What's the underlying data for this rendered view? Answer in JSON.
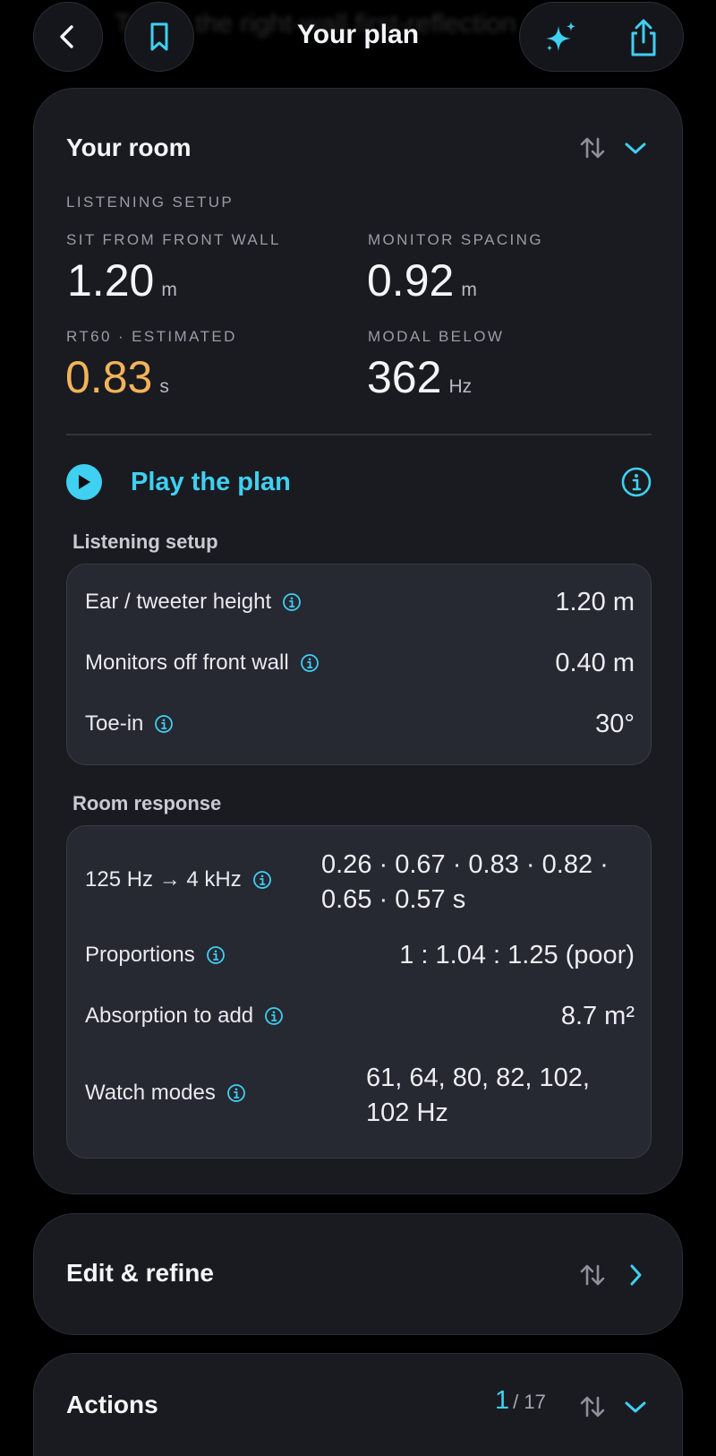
{
  "topbar": {
    "title": "Your plan",
    "behind_text": "Toe-in the right-wall first-reflection",
    "icons": {
      "back": "chevron-left-icon",
      "bookmark": "bookmark-icon",
      "sparkle": "sparkle-icon",
      "share": "share-icon"
    }
  },
  "room_card": {
    "title": "Your room",
    "section_label": "LISTENING SETUP",
    "metrics": [
      {
        "label": "SIT FROM FRONT WALL",
        "value": "1.20",
        "unit": "m"
      },
      {
        "label": "MONITOR SPACING",
        "value": "0.92",
        "unit": "m"
      },
      {
        "label": "RT60 · ESTIMATED",
        "value": "0.83",
        "unit": "s"
      },
      {
        "label": "MODAL BELOW",
        "value": "362",
        "unit": "Hz"
      }
    ],
    "play_label": "Play the plan",
    "listening_group": {
      "label": "Listening setup",
      "rows": [
        {
          "label": "Ear / tweeter height",
          "value": "1.20 m"
        },
        {
          "label": "Monitors off front wall",
          "value": "0.40 m"
        },
        {
          "label": "Toe-in",
          "value": "30°"
        }
      ]
    },
    "response_group": {
      "label": "Room response",
      "rows": [
        {
          "label": "125 Hz → 4 kHz",
          "value": "0.26 · 0.67 · 0.83 · 0.82 · 0.65 · 0.57 s"
        },
        {
          "label": "Proportions",
          "value": "1 : 1.04 : 1.25 (poor)"
        },
        {
          "label": "Absorption to add",
          "value": "8.7 m²"
        },
        {
          "label": "Watch modes",
          "value": "61, 64, 80, 82, 102, 102 Hz"
        }
      ]
    }
  },
  "edit_card": {
    "title": "Edit & refine"
  },
  "actions_card": {
    "title": "Actions",
    "current": "1",
    "total": "/ 17"
  },
  "colors": {
    "accent": "#3fd0f2",
    "warning": "#f3b35a",
    "card_bg": "#1a1b20",
    "inner_bg": "#262832",
    "page_bg": "#000000"
  }
}
